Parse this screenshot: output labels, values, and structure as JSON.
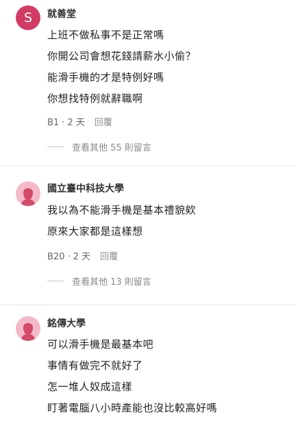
{
  "comments": [
    {
      "author": "就善堂",
      "avatar_letter": "S",
      "lines": [
        "上班不做私事不是正常嗎",
        "你開公司會想花錢請薪水小偷？",
        "能滑手機的才是特例好嗎",
        "你想找特例就辭職啊"
      ],
      "floor": "B1",
      "time": "2 天",
      "reply_label": "回覆",
      "more_label": "查看其他 55 則留言"
    },
    {
      "author": "國立臺中科技大學",
      "avatar_icon": "female-user-icon",
      "lines": [
        "我以為不能滑手機是基本禮貌欸",
        "原來大家都是這樣想"
      ],
      "floor": "B20",
      "time": "2 天",
      "reply_label": "回覆",
      "more_label": "查看其他 13 則留言"
    },
    {
      "author": "銘傳大學",
      "avatar_icon": "female-user-icon",
      "lines": [
        "可以滑手機是最基本吧",
        "事情有做完不就好了",
        "怎一堆人奴成這樣",
        "盯著電腦八小時產能也沒比較高好嗎"
      ]
    }
  ],
  "colors": {
    "avatar_letter_bg": "#d23b63",
    "avatar_female_bg": "#f4b9c6",
    "avatar_female_fg": "#d24a68"
  }
}
